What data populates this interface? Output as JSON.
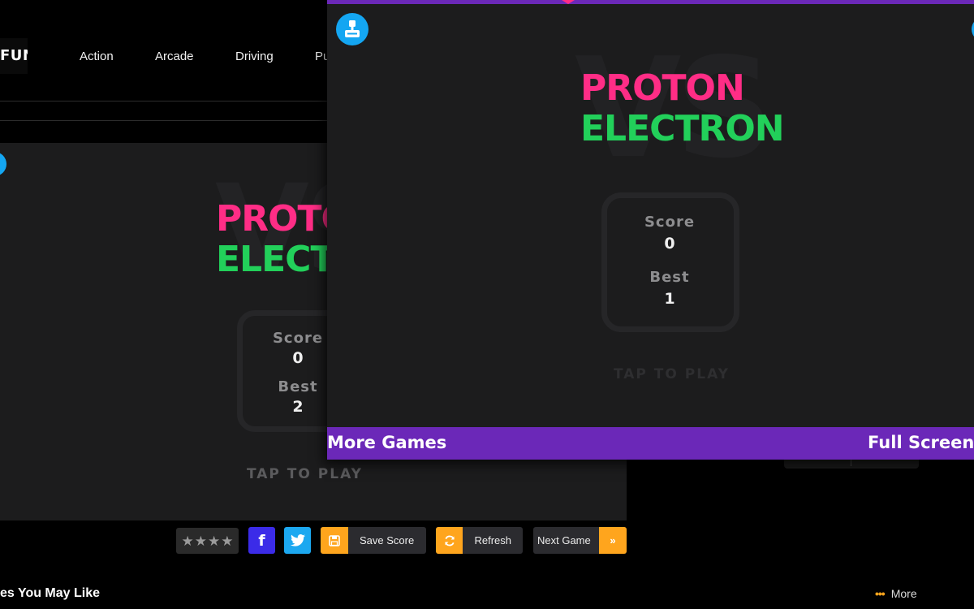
{
  "site": {
    "logo_text": "FUN",
    "nav": [
      "Action",
      "Arcade",
      "Driving",
      "Pu"
    ]
  },
  "game": {
    "title_line1": "PROTON",
    "title_line2": "ELECTRON",
    "vs_watermark": "VS",
    "score_label": "Score",
    "best_label": "Best",
    "tap_to_play": "TAP TO PLAY",
    "colors": {
      "proton": "#ff2d86",
      "electron": "#22d05a",
      "bar": "#6b28b8",
      "badge": "#14a6f2"
    }
  },
  "background_game": {
    "score": "0",
    "best": "2",
    "title_line1": "PROTO",
    "title_line2": "ELECTR"
  },
  "foreground_game": {
    "score": "0",
    "best": "1",
    "more_games": "More Games",
    "full_screen": "Full Screen"
  },
  "actions": {
    "rating_stars": 4,
    "facebook_glyph": "f",
    "save_score": "Save Score",
    "refresh": "Refresh",
    "next_game": "Next Game",
    "next_glyph": "»",
    "accent": "#ffa51d"
  },
  "section": {
    "title": "es You May Like",
    "more": "More",
    "more_dots": "•••"
  }
}
